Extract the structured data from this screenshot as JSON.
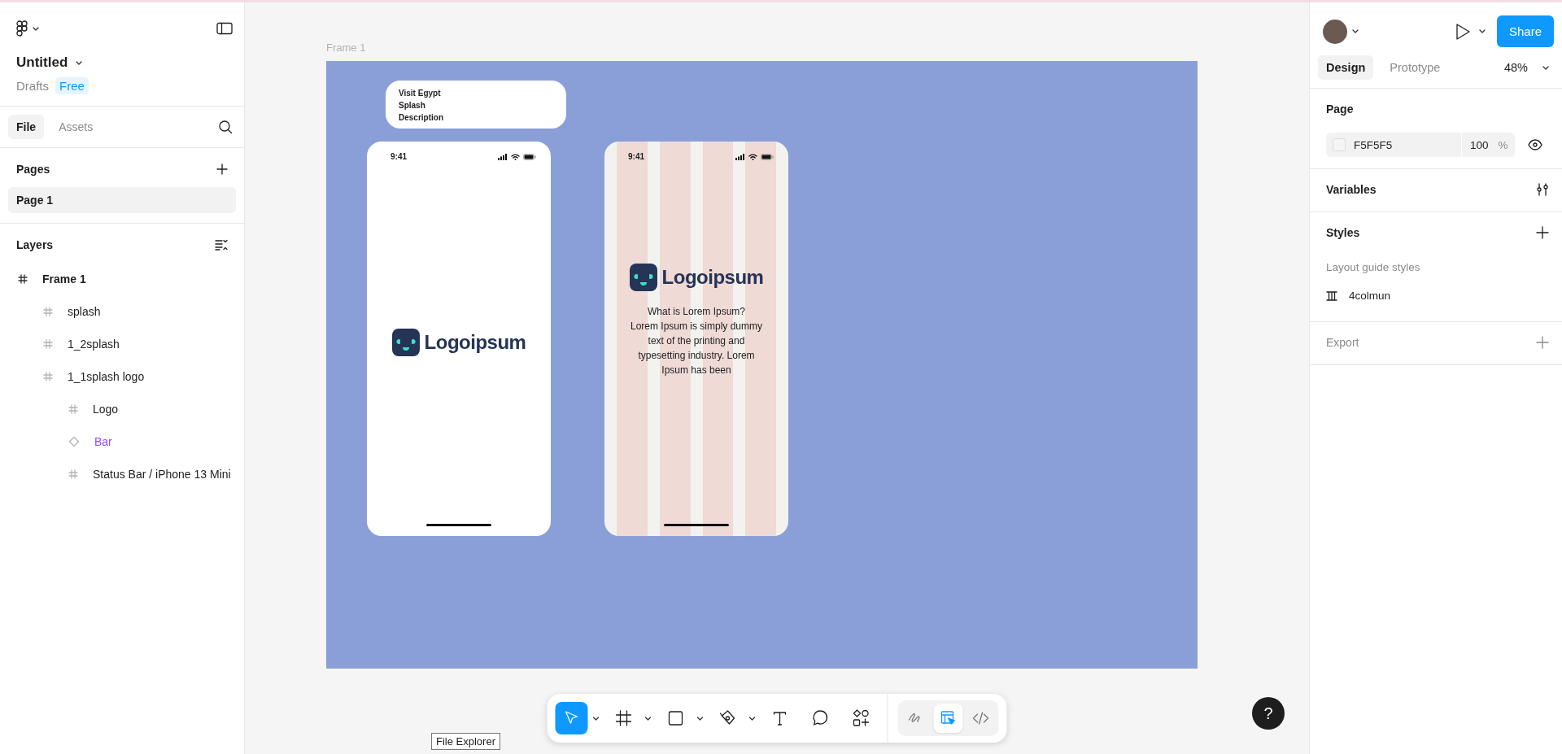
{
  "left_panel": {
    "file_title": "Untitled",
    "location": "Drafts",
    "plan_badge": "Free",
    "tabs": [
      {
        "label": "File",
        "selected": true
      },
      {
        "label": "Assets",
        "selected": false
      }
    ],
    "pages": {
      "title": "Pages",
      "items": [
        {
          "label": "Page 1",
          "selected": true
        }
      ]
    },
    "layers": {
      "title": "Layers",
      "tree": [
        {
          "name": "Frame 1",
          "kind": "frame",
          "selected": false,
          "children": [
            {
              "name": "splash",
              "kind": "frame",
              "selected": false
            },
            {
              "name": "1_2splash",
              "kind": "frame",
              "selected": false
            },
            {
              "name": "1_1splash logo",
              "kind": "frame",
              "selected": false,
              "children": [
                {
                  "name": "Logo",
                  "kind": "frame",
                  "selected": false
                },
                {
                  "name": "Bar",
                  "kind": "component",
                  "selected": false
                },
                {
                  "name": "Status Bar / iPhone 13 Mini",
                  "kind": "frame",
                  "selected": false
                }
              ]
            }
          ]
        }
      ]
    }
  },
  "canvas": {
    "frame_label": "Frame 1",
    "note": {
      "lines": [
        "Visit Egypt",
        "Splash",
        "Description"
      ]
    },
    "phones": [
      {
        "kind": "plain",
        "time": "9:41",
        "logo_text": "Logoipsum"
      },
      {
        "kind": "grid",
        "time": "9:41",
        "logo_text": "Logoipsum",
        "description": [
          "What is Lorem Ipsum?",
          "Lorem Ipsum is simply dummy",
          "text of the printing and",
          "typesetting industry. Lorem",
          "Ipsum has been"
        ]
      }
    ],
    "toolbar": {
      "tools": [
        {
          "kind": "move",
          "selected": true,
          "has_menu": true
        },
        {
          "kind": "frame",
          "selected": false,
          "has_menu": true
        },
        {
          "kind": "rectangle",
          "selected": false,
          "has_menu": true
        },
        {
          "kind": "pen",
          "selected": false,
          "has_menu": true
        },
        {
          "kind": "text",
          "selected": false,
          "has_menu": false
        },
        {
          "kind": "comment",
          "selected": false,
          "has_menu": false
        },
        {
          "kind": "shapes",
          "selected": false,
          "has_menu": false
        }
      ],
      "modes": [
        {
          "kind": "draw",
          "selected": false
        },
        {
          "kind": "design",
          "selected": true
        },
        {
          "kind": "dev",
          "selected": false
        }
      ]
    },
    "tooltip": "File Explorer",
    "help": "?"
  },
  "right_panel": {
    "share": "Share",
    "tabs": [
      {
        "label": "Design",
        "selected": true
      },
      {
        "label": "Prototype",
        "selected": false
      }
    ],
    "zoom": "48%",
    "page": {
      "title": "Page",
      "color_hex": "F5F5F5",
      "opacity": "100",
      "unit": "%"
    },
    "variables": {
      "title": "Variables"
    },
    "styles": {
      "title": "Styles",
      "group": "Layout guide styles",
      "items": [
        {
          "name": "4colmun"
        }
      ]
    },
    "export": {
      "title": "Export",
      "empty": true
    }
  }
}
